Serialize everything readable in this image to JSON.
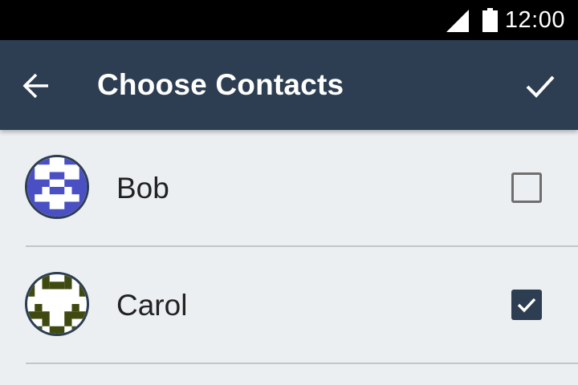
{
  "status_bar": {
    "time": "12:00",
    "icons": [
      "signal-icon",
      "battery-icon"
    ]
  },
  "app_bar": {
    "title": "Choose Contacts",
    "back_icon": "back-arrow-icon",
    "confirm_icon": "checkmark-icon"
  },
  "contacts": [
    {
      "name": "Bob",
      "checked": false,
      "avatar_color": "#4a4fc4",
      "avatar_icon": "identicon-avatar"
    },
    {
      "name": "Carol",
      "checked": true,
      "avatar_color": "#3f4a10",
      "avatar_icon": "identicon-avatar"
    }
  ],
  "colors": {
    "app_bar": "#2d3e52",
    "background": "#eceff2",
    "status_bar": "#000000",
    "checkbox_checked": "#2d3e52",
    "checkbox_unchecked_border": "#6e6e6e"
  }
}
